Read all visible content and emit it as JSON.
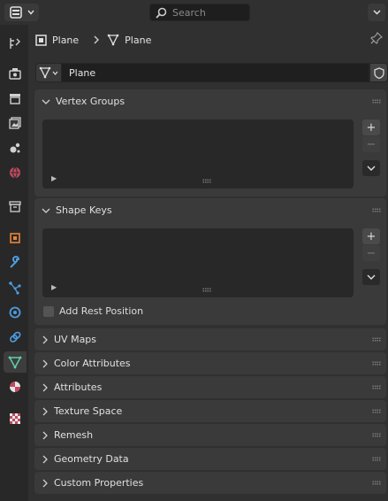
{
  "header": {
    "search_placeholder": "Search"
  },
  "breadcrumb": {
    "object_name": "Plane",
    "mesh_name": "Plane"
  },
  "datablock": {
    "name": "Plane"
  },
  "vertex_groups": {
    "title": "Vertex Groups",
    "add": "+",
    "remove": "−"
  },
  "shape_keys": {
    "title": "Shape Keys",
    "add": "+",
    "remove": "−",
    "add_rest_position": "Add Rest Position"
  },
  "collapsed_panels": [
    {
      "title": "UV Maps"
    },
    {
      "title": "Color Attributes"
    },
    {
      "title": "Attributes"
    },
    {
      "title": "Texture Space"
    },
    {
      "title": "Remesh"
    },
    {
      "title": "Geometry Data"
    },
    {
      "title": "Custom Properties"
    }
  ],
  "tabs": [
    {
      "name": "tool-icon"
    },
    {
      "name": "render-icon"
    },
    {
      "name": "output-icon"
    },
    {
      "name": "view-layer-icon"
    },
    {
      "name": "scene-icon"
    },
    {
      "name": "world-icon"
    },
    {
      "name": "collection-icon"
    },
    {
      "name": "object-icon"
    },
    {
      "name": "modifier-icon"
    },
    {
      "name": "particles-icon"
    },
    {
      "name": "physics-icon"
    },
    {
      "name": "constraints-icon"
    },
    {
      "name": "data-icon",
      "active": true
    },
    {
      "name": "material-icon"
    },
    {
      "name": "texture-icon"
    }
  ],
  "colors": {
    "accent_green": "#5fd0a8",
    "object_orange": "#e8843a",
    "tool_blue": "#4e9ce0"
  }
}
